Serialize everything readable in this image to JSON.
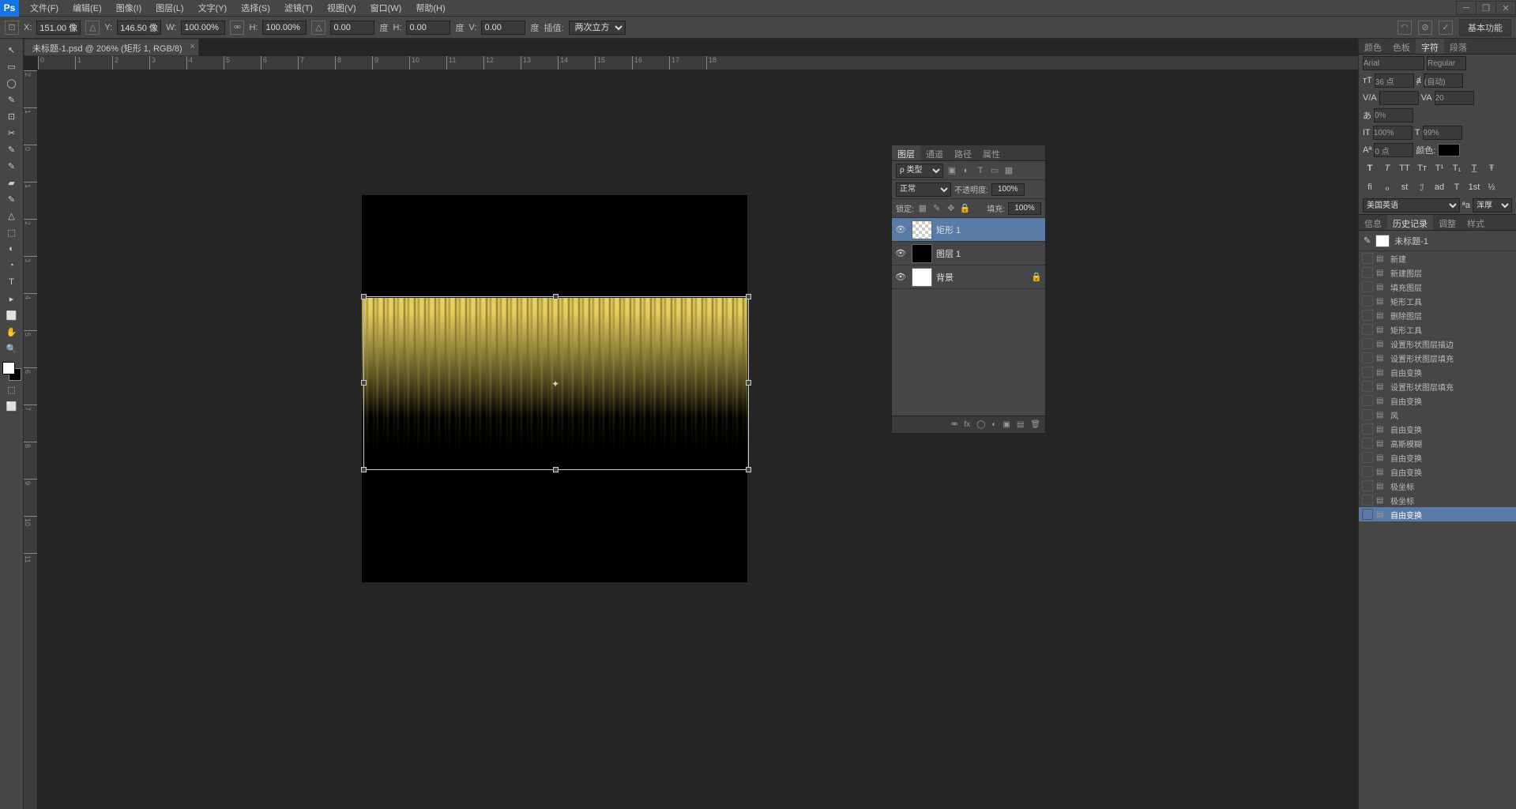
{
  "app": "Ps",
  "menu": [
    "文件(F)",
    "编辑(E)",
    "图像(I)",
    "图层(L)",
    "文字(Y)",
    "选择(S)",
    "滤镜(T)",
    "视图(V)",
    "窗口(W)",
    "帮助(H)"
  ],
  "options": {
    "x_label": "X:",
    "x": "151.00 像",
    "y_label": "Y:",
    "y": "146.50 像",
    "w_label": "W:",
    "w": "100.00%",
    "h_label": "H:",
    "h": "100.00%",
    "angle": "0.00",
    "angle_label": "度",
    "h_skew_label": "H:",
    "h_skew": "0.00",
    "v_skew_label": "V:",
    "v_skew": "0.00",
    "interp_label": "插值:",
    "interp": "两次立方"
  },
  "workspace_button": "基本功能",
  "doc_tab": "未标题-1.psd @ 206% (矩形 1, RGB/8)",
  "ruler_h": [
    "0",
    "1",
    "2",
    "3",
    "4",
    "5",
    "6",
    "7",
    "8",
    "9",
    "10",
    "11",
    "12",
    "13",
    "14",
    "15",
    "16",
    "17",
    "18"
  ],
  "ruler_v": [
    "2",
    "1",
    "0",
    "1",
    "2",
    "3",
    "4",
    "5",
    "6",
    "7",
    "8",
    "9",
    "10",
    "11"
  ],
  "layers_panel": {
    "tabs": [
      "图层",
      "通道",
      "路径",
      "属性"
    ],
    "kind_label": "ρ 类型",
    "blend_mode": "正常",
    "opacity_label": "不透明度:",
    "opacity": "100%",
    "lock_label": "锁定:",
    "fill_label": "填充:",
    "fill": "100%",
    "layers": [
      {
        "name": "矩形 1",
        "thumb": "chk",
        "active": true
      },
      {
        "name": "图层 1",
        "thumb": "blk"
      },
      {
        "name": "背景",
        "thumb": "white",
        "locked": true
      }
    ]
  },
  "char_panel": {
    "tabs": [
      "颜色",
      "色板",
      "字符",
      "段落"
    ],
    "font": "Arial",
    "style": "Regular",
    "size": "36 点",
    "leading": "(自动)",
    "kerning": "",
    "tracking": "20",
    "scale": "0%",
    "vscale": "100%",
    "hscale": "99%",
    "baseline": "0 点",
    "color_label": "颜色:",
    "lang": "美国英语",
    "render": "浑厚"
  },
  "history_panel": {
    "tabs": [
      "信息",
      "历史记录",
      "调整",
      "样式"
    ],
    "doc": "未标题-1",
    "items": [
      "新建",
      "新建图层",
      "填充图层",
      "矩形工具",
      "删除图层",
      "矩形工具",
      "设置形状图层描边",
      "设置形状图层填充",
      "自由变换",
      "设置形状图层填充",
      "自由变换",
      "风",
      "自由变换",
      "高斯模糊",
      "自由变换",
      "自由变换",
      "极坐标",
      "极坐标",
      "自由变换"
    ],
    "active_index": 18
  },
  "tools": [
    "↖",
    "▭",
    "◯",
    "✎",
    "⊡",
    "✂",
    "✎",
    "✎",
    "▰",
    "✎",
    "△",
    "⬚",
    "◐",
    "◔",
    "T",
    "▸",
    "⬜",
    "✋",
    "🔍"
  ]
}
